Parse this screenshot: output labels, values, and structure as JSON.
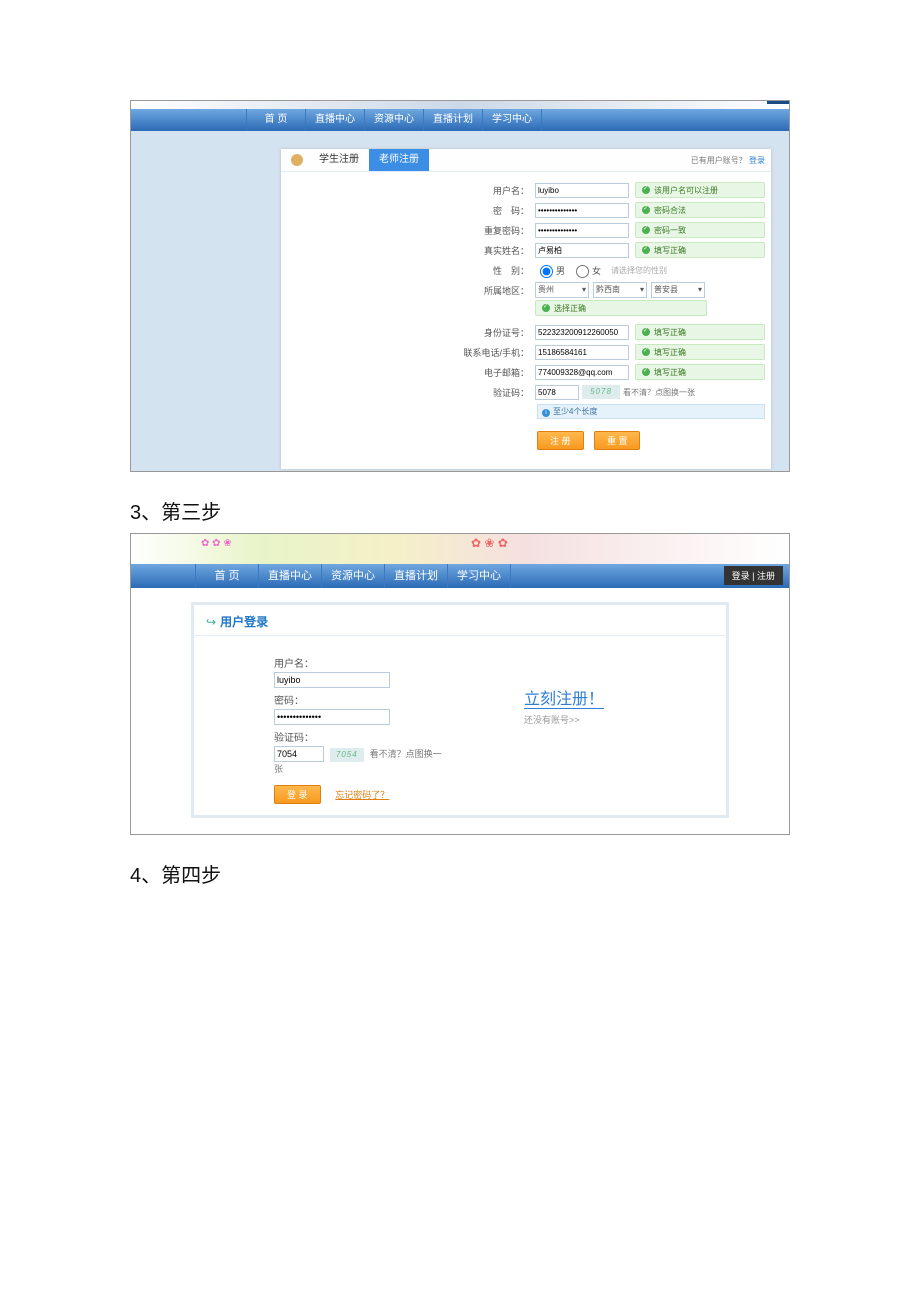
{
  "step3": "3、第三步",
  "step4": "4、第四步",
  "nav": {
    "items": [
      "首 页",
      "直播中心",
      "资源中心",
      "直播计划",
      "学习中心"
    ],
    "login_corner": "登录"
  },
  "reg": {
    "tab_student": "学生注册",
    "tab_teacher": "老师注册",
    "has_account": "已有用户账号？",
    "login_link": "登录",
    "fields": {
      "username_label": "用户名：",
      "username_value": "luyibo",
      "username_hint": "该用户名可以注册",
      "password_label": "密　码：",
      "password_value": "••••••••••••••",
      "password_hint": "密码合法",
      "password2_label": "重复密码：",
      "password2_value": "••••••••••••••",
      "password2_hint": "密码一致",
      "realname_label": "真实姓名：",
      "realname_value": "卢易柏",
      "realname_hint": "填写正确",
      "gender_label": "性　别：",
      "gender_male": "男",
      "gender_female": "女",
      "gender_hint": "请选择您的性别",
      "region_label": "所属地区：",
      "region_province": "贵州",
      "region_city": "黔西南",
      "region_county": "普安县",
      "region_hint": "选择正确",
      "idno_label": "身份证号：",
      "idno_value": "522323200912260050",
      "idno_hint": "填写正确",
      "phone_label": "联系电话/手机：",
      "phone_value": "15186584161",
      "phone_hint": "填写正确",
      "email_label": "电子邮箱：",
      "email_value": "774009328@qq.com",
      "email_hint": "填写正确",
      "captcha_label": "验证码：",
      "captcha_value": "5078",
      "captcha_img": "5078",
      "captcha_refresh": "看不清？点图换一张",
      "captcha_len_hint": "至少4个长度"
    },
    "btn_register": "注 册",
    "btn_reset": "重 置"
  },
  "login": {
    "corner": "登录 | 注册",
    "panel_title": "用户登录",
    "username_label": "用户名：",
    "username_value": "luyibo",
    "password_label": "密码：",
    "password_value": "••••••••••••••",
    "captcha_label": "验证码：",
    "captcha_value": "7054",
    "captcha_img": "7054",
    "captcha_refresh": "看不清？点图换一张",
    "btn_login": "登 录",
    "forgot": "忘记密码了？",
    "register_now": "立刻注册！",
    "no_account": "还没有账号>>"
  }
}
